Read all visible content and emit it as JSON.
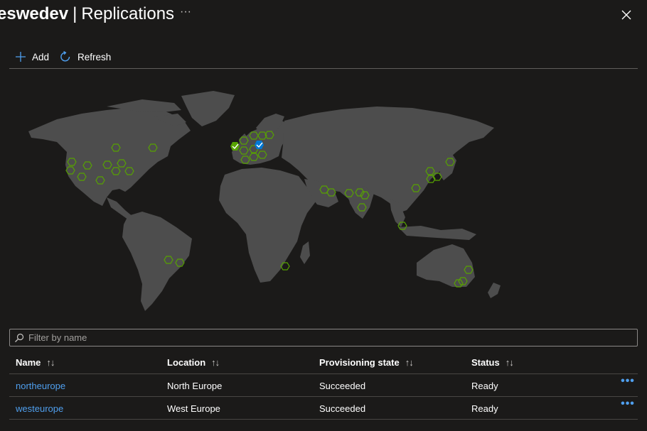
{
  "header": {
    "title_resource": "eswedev",
    "title_separator": "|",
    "title_page": "Replications",
    "more_glyph": "···",
    "close_icon": "close-icon"
  },
  "toolbar": {
    "add_label": "Add",
    "refresh_label": "Refresh"
  },
  "filter": {
    "placeholder": "Filter by name",
    "value": ""
  },
  "table": {
    "columns": [
      {
        "label": "Name",
        "sort_glyph": "↑↓"
      },
      {
        "label": "Location",
        "sort_glyph": "↑↓"
      },
      {
        "label": "Provisioning state",
        "sort_glyph": "↑↓"
      },
      {
        "label": "Status",
        "sort_glyph": "↑↓"
      }
    ],
    "rows": [
      {
        "name": "northeurope",
        "location": "North Europe",
        "provisioning_state": "Succeeded",
        "status": "Ready",
        "more": "•••"
      },
      {
        "name": "westeurope",
        "location": "West Europe",
        "provisioning_state": "Succeeded",
        "status": "Ready",
        "more": "•••"
      }
    ]
  },
  "map": {
    "available_region_count": 42,
    "replicated_regions": [
      {
        "name": "northeurope",
        "marker_color": "#57a300"
      },
      {
        "name": "westeurope",
        "marker_color": "#0078d4"
      }
    ]
  },
  "colors": {
    "background": "#1b1a19",
    "land": "#4d4d4d",
    "region_hex": "#57a300",
    "link": "#4f9fee",
    "home_region": "#0078d4"
  }
}
